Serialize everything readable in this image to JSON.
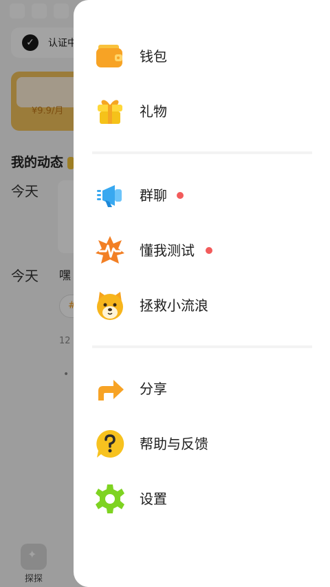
{
  "background": {
    "verify_text": "认证中",
    "vip_price": "¥9.9/月",
    "section_title": "我的动态",
    "today_1": "今天",
    "today_2": "今天",
    "post_snippet": "嘿",
    "tag_char": "#",
    "post_time": "12",
    "more_dots": "• • •",
    "tab_label": "探探"
  },
  "menu": {
    "items": [
      {
        "label": "钱包",
        "icon": "wallet-icon",
        "color": "#f7a325"
      },
      {
        "label": "礼物",
        "icon": "gift-icon",
        "color": "#f5c21a"
      },
      {
        "label": "群聊",
        "icon": "megaphone-icon",
        "color": "#38a8f0",
        "badge": true
      },
      {
        "label": "懂我测试",
        "icon": "heartbeat-star-icon",
        "color": "#f27f24",
        "badge": true
      },
      {
        "label": "拯救小流浪",
        "icon": "dog-face-icon",
        "color": "#f7b51c"
      },
      {
        "label": "分享",
        "icon": "share-arrow-icon",
        "color": "#f7a325"
      },
      {
        "label": "帮助与反馈",
        "icon": "help-bubble-icon",
        "color": "#f7c21f"
      },
      {
        "label": "设置",
        "icon": "gear-icon",
        "color": "#7ed321"
      }
    ]
  },
  "colors": {
    "badge": "#f25b5b",
    "scrim": "rgba(0,0,0,0.36)"
  }
}
